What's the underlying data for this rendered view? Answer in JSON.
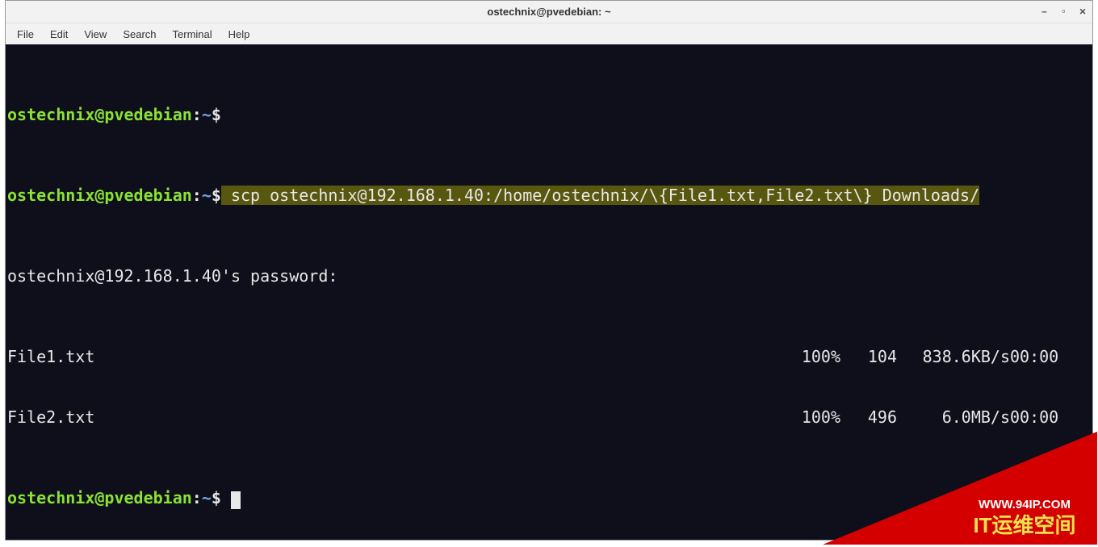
{
  "window": {
    "title": "ostechnix@pvedebian: ~"
  },
  "menubar": {
    "file": "File",
    "edit": "Edit",
    "view": "View",
    "search": "Search",
    "terminal": "Terminal",
    "help": "Help"
  },
  "prompt": {
    "userhost": "ostechnix@pvedebian",
    "colon": ":",
    "path": "~",
    "dollar": "$"
  },
  "command": " scp ostechnix@192.168.1.40:/home/ostechnix/\\{File1.txt,File2.txt\\} Downloads/",
  "password_prompt": "ostechnix@192.168.1.40's password:",
  "transfers": [
    {
      "name": "File1.txt",
      "pct": "100%",
      "size": "104",
      "speed": "838.6KB/s",
      "eta": "00:00"
    },
    {
      "name": "File2.txt",
      "pct": "100%",
      "size": "496",
      "speed": "6.0MB/s",
      "eta": "00:00"
    }
  ],
  "watermark": {
    "url": "WWW.94IP.COM",
    "text": "IT运维空间"
  }
}
